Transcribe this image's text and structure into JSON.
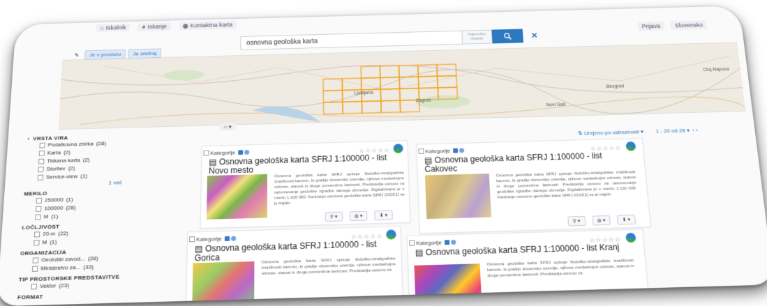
{
  "topbar": {
    "tabs": [
      "Iskalnik",
      "Iskanje",
      "Kontaktna karta"
    ]
  },
  "header_right": {
    "login": "Prijava",
    "user_menu": "Slovensko"
  },
  "search": {
    "value": "osnovna geološka karta",
    "hint": "Napredno iskanje",
    "button_icon": "search-icon",
    "clear_icon": "close-icon"
  },
  "map_toolbar": {
    "btn_extent": "Je v prostoru",
    "btn_intersect": "Je znotraj"
  },
  "map": {
    "labels": [
      "Ljubljana",
      "Zagreb",
      "Novi Sad",
      "Cluj-Napoca",
      "Beograd"
    ]
  },
  "sort": {
    "label": "Urejeno po ustreznosti",
    "pager": "1 - 20 od 28"
  },
  "facets": [
    {
      "title": "VRSTA VIRA",
      "items": [
        {
          "label": "Podatkovna zbirka",
          "count": "(28)"
        },
        {
          "label": "Karta",
          "count": "(2)"
        },
        {
          "label": "Tiskana karta",
          "count": "(2)"
        },
        {
          "label": "Storitev",
          "count": "(2)"
        },
        {
          "label": "Service-view",
          "count": "(1)"
        }
      ],
      "more": "1 več"
    },
    {
      "title": "MERILO",
      "items": [
        {
          "label": "250000",
          "count": "(1)"
        },
        {
          "label": "100000",
          "count": "(28)"
        },
        {
          "label": "M",
          "count": "(1)"
        }
      ]
    },
    {
      "title": "LOČLJIVOST",
      "items": [
        {
          "label": "20 m",
          "count": "(22)"
        },
        {
          "label": "M",
          "count": "(1)"
        }
      ]
    },
    {
      "title": "ORGANIZACIJA",
      "items": [
        {
          "label": "Geološki zavod...",
          "count": "(28)"
        },
        {
          "label": "Ministrstvo za...",
          "count": "(33)"
        }
      ]
    },
    {
      "title": "TIP PROSTORSKE PREDSTAVITVE",
      "items": [
        {
          "label": "Vektor",
          "count": "(23)"
        }
      ]
    },
    {
      "title": "FORMAT",
      "items": []
    }
  ],
  "cards": [
    {
      "category": "Kategorije",
      "title": "Osnovna geološka karta SFRJ 1:100000 - list Novo mesto",
      "desc": "Osnovna geološka karta SFRJ opisuje litološko-stratigrafske značilnosti kamnin, ki gradijo slovensko ozemlje, njihove medsebojne odnose, starost in druge pomembne lastnosti. Predstavlja osnovo za razumevanje geološke zgradbe danega območja. Digitalizirana je v merilu 1:100 000. Kartiranje osnovne geološke karte SFRJ (OGK1) se je trajalo"
    },
    {
      "category": "Kategorije",
      "title": "Osnovna geološka karta SFRJ 1:100000 - list Čakovec",
      "desc": "Osnovna geološka karta SFRJ opisuje litološko-stratigrafske značilnosti kamnin, ki gradijo slovensko ozemlje, njihove medsebojne odnose, starost in druge pomembne lastnosti. Predstavlja osnovo za razumevanje geološke zgradbe danega območja. Digitalizirana je v merilu 1:100 000. Kartiranje osnovne geološke karte SFRJ (OGK1) se je trajalo"
    },
    {
      "category": "Kategorije",
      "title": "Osnovna geološka karta SFRJ 1:100000 - list Gorica",
      "desc": "Osnovna geološka karta SFRJ opisuje litološko-stratigrafske značilnosti kamnin, ki gradijo slovensko ozemlje, njihove medsebojne odnose, starost in druge pomembne lastnosti. Predstavlja osnovo za"
    },
    {
      "category": "Kategorije",
      "title": "Osnovna geološka karta SFRJ 1:100000 - list Kranj",
      "desc": "Osnovna geološka karta SFRJ opisuje litološko-stratigrafske značilnosti kamnin, ki gradijo slovensko ozemlje, njihove medsebojne odnose, starost in druge pomembne lastnosti. Predstavlja osnovo za"
    }
  ],
  "colors": {
    "accent": "#2d79bf",
    "footprint": "#f0a21c"
  }
}
